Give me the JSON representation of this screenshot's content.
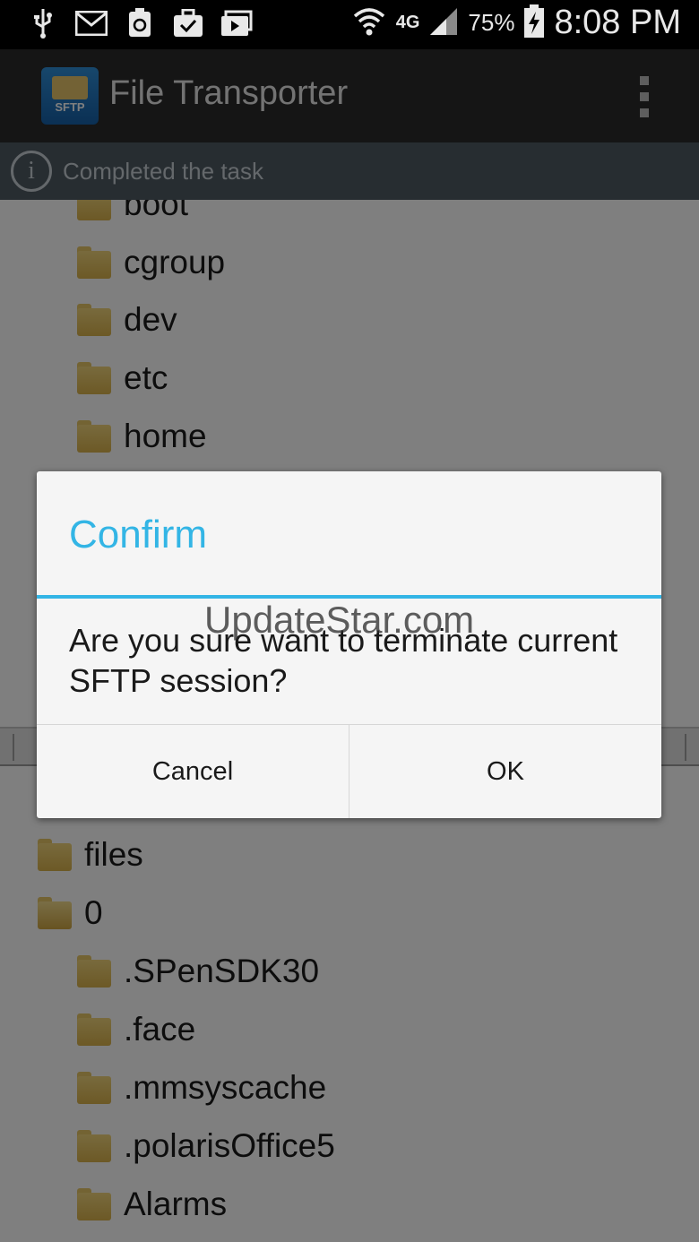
{
  "status_bar": {
    "left_icons": [
      "usb-icon",
      "gmail-icon",
      "recycle-icon",
      "briefcase-check-icon",
      "media-icon"
    ],
    "network": "4G",
    "battery_percent": "75%",
    "time": "8:08 PM"
  },
  "action_bar": {
    "app_icon_label": "SFTP",
    "title": "File Transporter"
  },
  "info_bar": {
    "text": "Completed the task"
  },
  "remote_list": {
    "items": [
      {
        "label": "boot"
      },
      {
        "label": "cgroup"
      },
      {
        "label": "dev"
      },
      {
        "label": "etc"
      },
      {
        "label": "home"
      }
    ]
  },
  "local_list": {
    "items": [
      {
        "label": "files"
      },
      {
        "label": "0"
      },
      {
        "label": ".SPenSDK30"
      },
      {
        "label": ".face"
      },
      {
        "label": ".mmsyscache"
      },
      {
        "label": ".polarisOffice5"
      },
      {
        "label": "Alarms"
      }
    ]
  },
  "dialog": {
    "title": "Confirm",
    "message": "Are you sure want to terminate current SFTP session?",
    "cancel_label": "Cancel",
    "ok_label": "OK"
  },
  "watermark": "UpdateStar.com",
  "colors": {
    "accent": "#33b5e5",
    "action_bar": "#2a2a2a",
    "info_bar": "#4f5a63"
  }
}
